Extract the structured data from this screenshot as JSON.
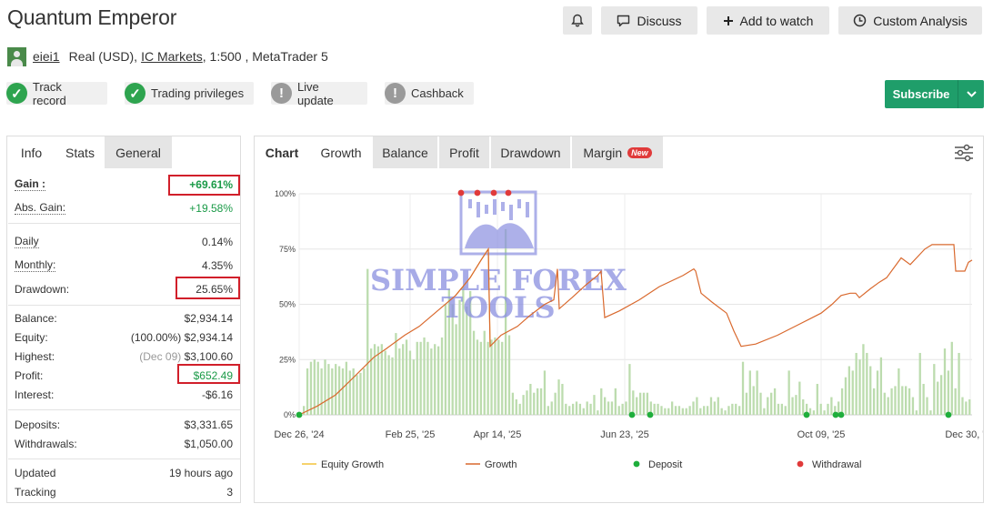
{
  "header": {
    "title": "Quantum Emperor",
    "buttons": {
      "discuss": "Discuss",
      "watch": "Add to watch",
      "custom": "Custom Analysis"
    }
  },
  "account": {
    "user": "eiei1",
    "type": "Real (USD),",
    "broker": "IC Markets",
    "leverage": ", 1:500 , MetaTrader 5"
  },
  "badges": [
    {
      "label": "Track record",
      "status": "ok"
    },
    {
      "label": "Trading privileges",
      "status": "ok"
    },
    {
      "label": "Live update",
      "status": "na"
    },
    {
      "label": "Cashback",
      "status": "na"
    }
  ],
  "subscribe_label": "Subscribe",
  "left_tabs": [
    "Info",
    "Stats",
    "General"
  ],
  "stats": {
    "gain": {
      "k": "Gain :",
      "v": "+69.61%"
    },
    "abs_gain": {
      "k": "Abs. Gain:",
      "v": "+19.58%"
    },
    "daily": {
      "k": "Daily",
      "v": "0.14%"
    },
    "monthly": {
      "k": "Monthly:",
      "v": "4.35%"
    },
    "drawdown": {
      "k": "Drawdown:",
      "v": "25.65%"
    },
    "balance": {
      "k": "Balance:",
      "v": "$2,934.14"
    },
    "equity": {
      "k": "Equity:",
      "note": "(100.00%)",
      "v": "$2,934.14"
    },
    "highest": {
      "k": "Highest:",
      "note": "(Dec 09)",
      "v": "$3,100.60"
    },
    "profit": {
      "k": "Profit:",
      "v": "$652.49"
    },
    "interest": {
      "k": "Interest:",
      "v": "-$6.16"
    },
    "deposits": {
      "k": "Deposits:",
      "v": "$3,331.65"
    },
    "withdrawals": {
      "k": "Withdrawals:",
      "v": "$1,050.00"
    },
    "updated": {
      "k": "Updated",
      "v": "19 hours ago"
    },
    "tracking": {
      "k": "Tracking",
      "v": "3"
    }
  },
  "right_tabs": {
    "chart": "Chart",
    "growth": "Growth",
    "balance": "Balance",
    "profit": "Profit",
    "drawdown": "Drawdown",
    "margin": "Margin",
    "new_badge": "New"
  },
  "watermark": {
    "line1": "SIMPLE FOREX",
    "line2": "TOOLS"
  },
  "colors": {
    "gain_green": "#1a9a47",
    "highlight_red": "#d11f2a",
    "subscribe_green": "#1f9e6a",
    "growth_line": "#d9692e",
    "equity_line": "#f2c23a",
    "bar_fill": "#bcdcae",
    "deposit": "#1fae3c",
    "withdrawal": "#e03a3a"
  },
  "chart_data": {
    "type": "line",
    "x_ticks": [
      "Dec 26, '24",
      "Feb 25, '25",
      "Apr 14, '25",
      "Jun 23, '25",
      "Oct 09, '25",
      "Dec 30, '25"
    ],
    "y_ticks": [
      "0%",
      "25%",
      "50%",
      "75%",
      "100%"
    ],
    "ylim": [
      0,
      100
    ],
    "grid": true,
    "legend_position": "bottom",
    "legend": [
      "Equity Growth",
      "Growth",
      "Deposit",
      "Withdrawal"
    ],
    "growth": [
      [
        0,
        0
      ],
      [
        0.03,
        5
      ],
      [
        0.06,
        9
      ],
      [
        0.09,
        17
      ],
      [
        0.13,
        26
      ],
      [
        0.15,
        30
      ],
      [
        0.18,
        36
      ],
      [
        0.21,
        42
      ],
      [
        0.25,
        51
      ],
      [
        0.28,
        56
      ],
      [
        0.3,
        62
      ],
      [
        0.32,
        67
      ],
      [
        0.34,
        72
      ],
      [
        0.36,
        76
      ],
      [
        0.365,
        31
      ],
      [
        0.38,
        36
      ],
      [
        0.41,
        40
      ],
      [
        0.43,
        45
      ],
      [
        0.46,
        49
      ],
      [
        0.5,
        52
      ],
      [
        0.51,
        66
      ],
      [
        0.52,
        48
      ],
      [
        0.54,
        53
      ],
      [
        0.57,
        59
      ],
      [
        0.59,
        64
      ],
      [
        0.6,
        66
      ],
      [
        0.61,
        44
      ],
      [
        0.63,
        48
      ],
      [
        0.66,
        53
      ],
      [
        0.69,
        59
      ],
      [
        0.71,
        64
      ],
      [
        0.72,
        65
      ],
      [
        0.73,
        56
      ],
      [
        0.74,
        52
      ],
      [
        0.75,
        50
      ],
      [
        0.76,
        47
      ],
      [
        0.77,
        38
      ],
      [
        0.78,
        34
      ],
      [
        0.8,
        35
      ],
      [
        0.85,
        40
      ],
      [
        0.88,
        46
      ],
      [
        0.91,
        51
      ],
      [
        0.92,
        54
      ],
      [
        0.93,
        55
      ],
      [
        0.94,
        55
      ],
      [
        0.95,
        53
      ],
      [
        0.96,
        55
      ],
      [
        0.97,
        57
      ],
      [
        0.99,
        60
      ],
      [
        1.0,
        62
      ],
      [
        0.995,
        70
      ],
      [
        1.0,
        71
      ]
    ],
    "growth_dates": [
      [
        "2024-12-26",
        0
      ],
      [
        "2025-01-05",
        4
      ],
      [
        "2025-01-15",
        9
      ],
      [
        "2025-01-25",
        17
      ],
      [
        "2025-02-05",
        26
      ],
      [
        "2025-02-12",
        30
      ],
      [
        "2025-02-22",
        36
      ],
      [
        "2025-03-02",
        40
      ],
      [
        "2025-03-12",
        47
      ],
      [
        "2025-03-22",
        54
      ],
      [
        "2025-03-30",
        62
      ],
      [
        "2025-04-05",
        70
      ],
      [
        "2025-04-09",
        75
      ],
      [
        "2025-04-10",
        31
      ],
      [
        "2025-04-16",
        36
      ],
      [
        "2025-04-25",
        40
      ],
      [
        "2025-05-02",
        45
      ],
      [
        "2025-05-10",
        50
      ],
      [
        "2025-05-15",
        52
      ],
      [
        "2025-05-17",
        66
      ],
      [
        "2025-05-18",
        48
      ],
      [
        "2025-05-25",
        53
      ],
      [
        "2025-06-02",
        59
      ],
      [
        "2025-06-08",
        63
      ],
      [
        "2025-06-10",
        65
      ],
      [
        "2025-06-12",
        44
      ],
      [
        "2025-06-20",
        47
      ],
      [
        "2025-07-01",
        52
      ],
      [
        "2025-07-12",
        58
      ],
      [
        "2025-07-25",
        63
      ],
      [
        "2025-07-31",
        66
      ],
      [
        "2025-08-01",
        65
      ],
      [
        "2025-08-04",
        55
      ],
      [
        "2025-08-10",
        51
      ],
      [
        "2025-08-18",
        46
      ],
      [
        "2025-08-22",
        38
      ],
      [
        "2025-08-26",
        31
      ],
      [
        "2025-09-03",
        32
      ],
      [
        "2025-09-15",
        36
      ],
      [
        "2025-09-27",
        41
      ],
      [
        "2025-10-09",
        46
      ],
      [
        "2025-10-15",
        50
      ],
      [
        "2025-10-20",
        54
      ],
      [
        "2025-10-25",
        55
      ],
      [
        "2025-10-28",
        55
      ],
      [
        "2025-10-30",
        53
      ],
      [
        "2025-11-05",
        57
      ],
      [
        "2025-11-10",
        60
      ],
      [
        "2025-11-14",
        62
      ],
      [
        "2025-11-22",
        71
      ],
      [
        "2025-11-27",
        68
      ],
      [
        "2025-12-05",
        75
      ],
      [
        "2025-12-09",
        77
      ],
      [
        "2025-12-21",
        77
      ],
      [
        "2025-12-22",
        65
      ],
      [
        "2025-12-27",
        65
      ],
      [
        "2025-12-29",
        69
      ],
      [
        "2025-12-31",
        70
      ]
    ],
    "equity_dates": [
      [
        "2025-03-22",
        54
      ],
      [
        "2025-03-30",
        62
      ],
      [
        "2025-04-05",
        70
      ],
      [
        "2025-04-09",
        75
      ],
      [
        "2025-04-10",
        31
      ]
    ],
    "bars_profit_pct": [
      4,
      21,
      24,
      25,
      24,
      21,
      25,
      23,
      21,
      23,
      22,
      21,
      24,
      20,
      21,
      18,
      19,
      21,
      66,
      30,
      32,
      31,
      32,
      29,
      27,
      26,
      37,
      30,
      32,
      34,
      29,
      25,
      33,
      33,
      35,
      33,
      30,
      32,
      31,
      35,
      50,
      57,
      50,
      41,
      52,
      58,
      49,
      56,
      38,
      34,
      33,
      38,
      33,
      34,
      35,
      34,
      33,
      84,
      36,
      10,
      7,
      5,
      9,
      11,
      14,
      10,
      12,
      12,
      20,
      4,
      6,
      10,
      16,
      14,
      5,
      4,
      5,
      6,
      5,
      3,
      6,
      5,
      9,
      2,
      12,
      8,
      6,
      6,
      12,
      4,
      5,
      6,
      23,
      11,
      8,
      10,
      10,
      10,
      6,
      5,
      5,
      4,
      3,
      3,
      6,
      4,
      4,
      3,
      3,
      4,
      6,
      8,
      3,
      4,
      4,
      8,
      6,
      8,
      3,
      2,
      4,
      5,
      5,
      4,
      24,
      10,
      20,
      13,
      20,
      10,
      3,
      8,
      10,
      12,
      5,
      5,
      4,
      20,
      8,
      9,
      15,
      7,
      5,
      3,
      2,
      14,
      5,
      2,
      5,
      8,
      4,
      6,
      12,
      17,
      22,
      20,
      28,
      25,
      32,
      28,
      22,
      12,
      20,
      26,
      10,
      8,
      12,
      13,
      21,
      13,
      13,
      12,
      8,
      2,
      28,
      14,
      8,
      2,
      23,
      15,
      18,
      30,
      20,
      33,
      12,
      28,
      8,
      6,
      7
    ],
    "deposits_dates": [
      "2024-12-26",
      "2025-06-27",
      "2025-07-07",
      "2025-10-01",
      "2025-10-17",
      "2025-10-20",
      "2025-12-18"
    ],
    "withdrawals_dates": [
      "2025-03-25",
      "2025-04-03",
      "2025-04-12",
      "2025-04-20"
    ]
  }
}
